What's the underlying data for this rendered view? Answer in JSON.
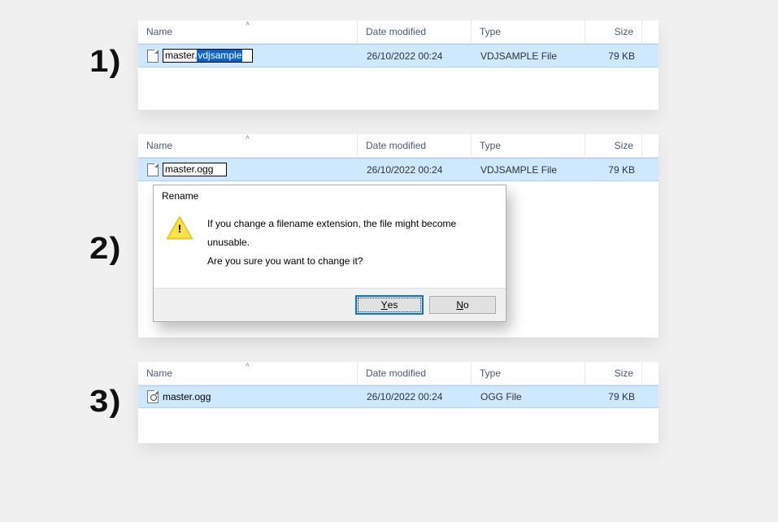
{
  "steps": {
    "s1": "1)",
    "s2": "2)",
    "s3": "3)"
  },
  "columns": {
    "name": "Name",
    "date": "Date modified",
    "type": "Type",
    "size": "Size",
    "sort_indicator": "˄"
  },
  "panel1": {
    "filename_prefix": "master.",
    "filename_selected": "vdjsample",
    "date": "26/10/2022 00:24",
    "type": "VDJSAMPLE File",
    "size": "79 KB"
  },
  "panel2": {
    "filename": "master.ogg",
    "date": "26/10/2022 00:24",
    "type": "VDJSAMPLE File",
    "size": "79 KB"
  },
  "panel3": {
    "filename": "master.ogg",
    "date": "26/10/2022 00:24",
    "type": "OGG File",
    "size": "79 KB"
  },
  "dialog": {
    "title": "Rename",
    "line1": "If you change a filename extension, the file might become unusable.",
    "line2": "Are you sure you want to change it?",
    "yes_mnemonic": "Y",
    "yes_rest": "es",
    "no_mnemonic": "N",
    "no_rest": "o"
  }
}
